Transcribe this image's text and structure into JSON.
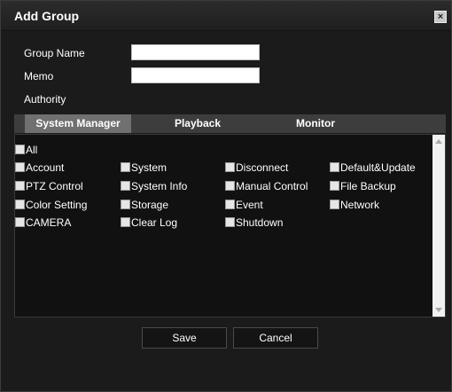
{
  "dialog": {
    "title": "Add Group",
    "close_glyph": "×"
  },
  "form": {
    "group_name_label": "Group Name",
    "group_name_value": "",
    "memo_label": "Memo",
    "memo_value": "",
    "authority_label": "Authority"
  },
  "tabs": [
    {
      "label": "System Manager",
      "active": true
    },
    {
      "label": "Playback",
      "active": false
    },
    {
      "label": "Monitor",
      "active": false
    }
  ],
  "permissions": {
    "all": "All",
    "items": [
      "Account",
      "System",
      "Disconnect",
      "Default&Update",
      "PTZ Control",
      "System Info",
      "Manual Control",
      "File Backup",
      "Color Setting",
      "Storage",
      "Event",
      "Network",
      "CAMERA",
      "Clear Log",
      "Shutdown"
    ]
  },
  "buttons": {
    "save": "Save",
    "cancel": "Cancel"
  },
  "colors": {
    "dialog_bg": "#1b1b1b",
    "tab_active": "#707070",
    "panel_bg": "#111111"
  },
  "icons": {
    "close": "close-icon",
    "scroll_up": "scroll-up-icon",
    "scroll_down": "scroll-down-icon"
  }
}
